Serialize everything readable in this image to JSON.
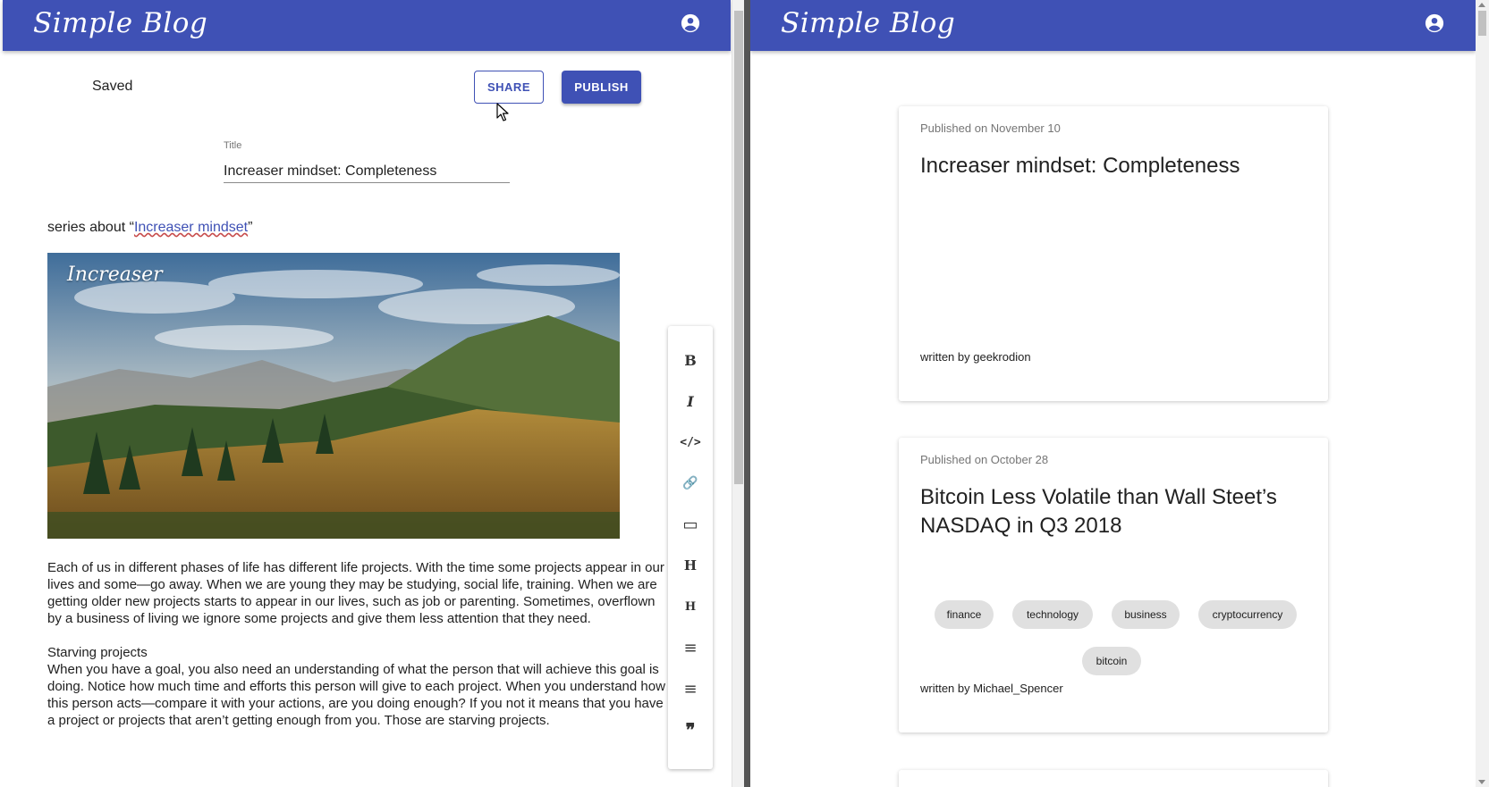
{
  "app": {
    "logo": "Simple Blog",
    "brand_color": "#3f51b5"
  },
  "editor": {
    "status": "Saved",
    "share_label": "SHARE",
    "publish_label": "PUBLISH",
    "title_label": "Title",
    "title_value": "Increaser mindset: Completeness",
    "series_prefix": "series about “",
    "series_link": "Increaser mindset",
    "series_suffix": "”",
    "image_caption": "Increaser",
    "paragraphs": [
      "Each of us in different phases of life has different life projects. With the time some projects appear in our lives and some—go away. When we are young they may be studying, social life, training. When we are getting older new projects starts to appear in our lives, such as job or parenting. Sometimes, overflown by a business of living we ignore some projects and give them less attention that they need.",
      "Starving projects",
      "When you have a goal, you also need an understanding of what the person that will achieve this goal is doing. Notice how much time and efforts this person will give to each project. When you understand how this person acts—compare it with your actions, are you doing enough? If you not it means that you have a project or projects that aren’t getting enough from you. Those are starving projects."
    ],
    "toolbar": [
      {
        "icon": "bold-icon",
        "glyph": "B"
      },
      {
        "icon": "italic-icon",
        "glyph": "I"
      },
      {
        "icon": "code-icon",
        "glyph": "</>"
      },
      {
        "icon": "link-icon",
        "glyph": "🔗"
      },
      {
        "icon": "image-icon",
        "glyph": "▭"
      },
      {
        "icon": "heading-one-icon",
        "glyph": "H"
      },
      {
        "icon": "heading-two-icon",
        "glyph": "H"
      },
      {
        "icon": "numbered-list-icon",
        "glyph": "≡"
      },
      {
        "icon": "bulleted-list-icon",
        "glyph": "≡"
      },
      {
        "icon": "quote-icon",
        "glyph": "❞"
      }
    ]
  },
  "feed": {
    "posts": [
      {
        "date": "Published on November 10",
        "title": "Increaser mindset: Completeness",
        "tags": [],
        "author": "written by geekrodion"
      },
      {
        "date": "Published on October 28",
        "title": "Bitcoin Less Volatile than Wall Steet’s NASDAQ in Q3 2018",
        "tags": [
          "finance",
          "technology",
          "business",
          "cryptocurrency",
          "bitcoin"
        ],
        "author": "written by Michael_Spencer"
      }
    ]
  }
}
